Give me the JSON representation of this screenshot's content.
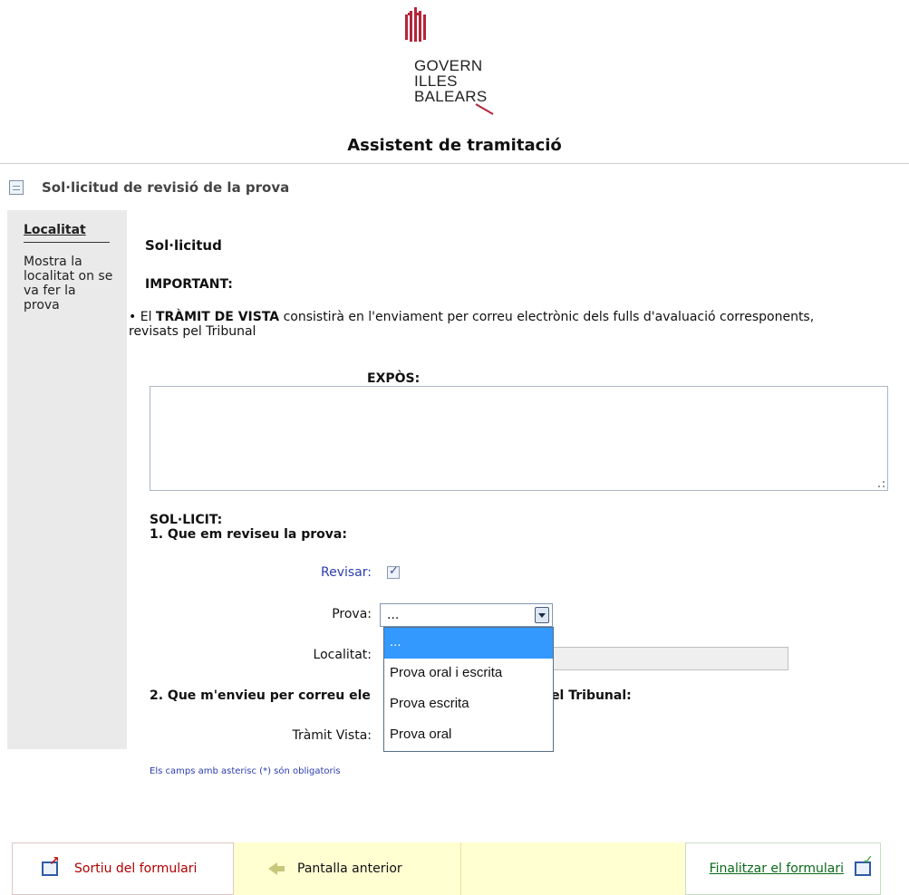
{
  "brand": {
    "logo_lines": [
      "GOVERN",
      "ILLES",
      "BALEARS"
    ],
    "stripe_color": "#b3263a"
  },
  "app_title": "Assistent de tramitació",
  "form": {
    "title": "Sol·licitud de revisió de la prova"
  },
  "help": {
    "title": "Localitat",
    "text": "Mostra la localitat on se va fer la prova"
  },
  "main": {
    "section_title": "Sol·licitud",
    "important_label": "IMPORTANT:",
    "bullet_prefix": "El ",
    "bullet_bold": "TRÀMIT DE VISTA",
    "bullet_rest": " consistirà en l'enviament per correu electrònic dels fulls d'avaluació corresponents, revisats pel Tribunal",
    "expos_label": "EXPÒS:",
    "expos_value": "",
    "solicit_label": "SOL·LICIT:",
    "item1": "1. Que em reviseu la prova:",
    "revisar_label": "Revisar:",
    "revisar_checked": true,
    "prova_label": "Prova:",
    "prova_value": "...",
    "prova_options": [
      "...",
      "Prova oral i escrita",
      "Prova escrita",
      "Prova oral"
    ],
    "prova_selected_index": 0,
    "localitat_label": "Localitat:",
    "localitat_value": "",
    "item2_start": "2. Que m'envieu per correu ele",
    "item2_end": "la pel Tribunal:",
    "tramit_label": "Tràmit Vista:",
    "required_note": "Els camps amb asterisc (*) són obligatoris"
  },
  "footer": {
    "exit_label": "Sortiu del formulari",
    "prev_label": "Pantalla anterior",
    "finish_label": "Finalitzar el formulari"
  },
  "colors": {
    "accent_blue": "#2c3db0",
    "exit_red": "#b00000",
    "finish_green": "#0a6a1a",
    "nav_yellow": "#ffffd2",
    "selected_option": "#3399ff"
  }
}
